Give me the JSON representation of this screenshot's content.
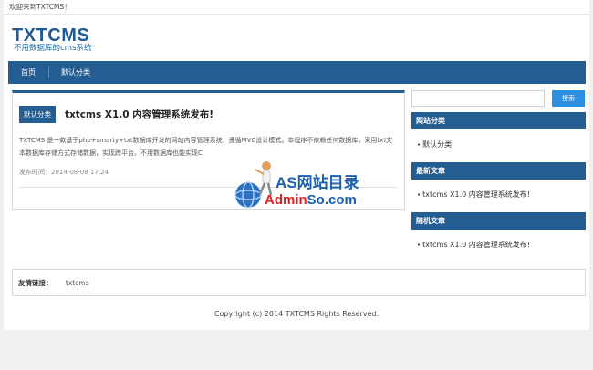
{
  "topbar": {
    "welcome": "欢迎来到TXTCMS！"
  },
  "header": {
    "site_title": "TXTCMS",
    "site_subtitle": "不用数据库的cms系统"
  },
  "nav": {
    "items": [
      {
        "label": "首页"
      },
      {
        "label": "默认分类"
      }
    ]
  },
  "post": {
    "category": "默认分类",
    "title": "txtcms X1.0 内容管理系统发布!",
    "excerpt": "TXTCMS 是一款基于php+smarty+txt数据库开发的网站内容管理系统，遵循MVC设计模式。本程序不依赖任何数据库，采用txt文本数据库存储方式存储数据，实现跨平台。不用数据库也能实现C",
    "date": "发布时间：2014-08-08 17:24"
  },
  "search": {
    "placeholder": "",
    "button_label": "搜索"
  },
  "sidebar": {
    "categories": {
      "title": "网站分类",
      "items": [
        {
          "label": "默认分类"
        }
      ]
    },
    "latest": {
      "title": "最新文章",
      "items": [
        {
          "label": "txtcms X1.0 内容管理系统发布!"
        }
      ]
    },
    "random": {
      "title": "随机文章",
      "items": [
        {
          "label": "txtcms X1.0 内容管理系统发布!"
        }
      ]
    }
  },
  "friend_links": {
    "label": "友情链接：",
    "items": [
      {
        "label": "txtcms"
      }
    ]
  },
  "footer": {
    "copyright": "Copyright (c) 2014 TXTCMS Rights Reserved."
  },
  "watermark": {
    "line1": "AS网站目录",
    "line2_red": "Admin",
    "line2_blue": "So.com"
  },
  "colors": {
    "primary": "#245d92",
    "search_button": "#2e8ee0",
    "logo": "#1e5b94"
  }
}
